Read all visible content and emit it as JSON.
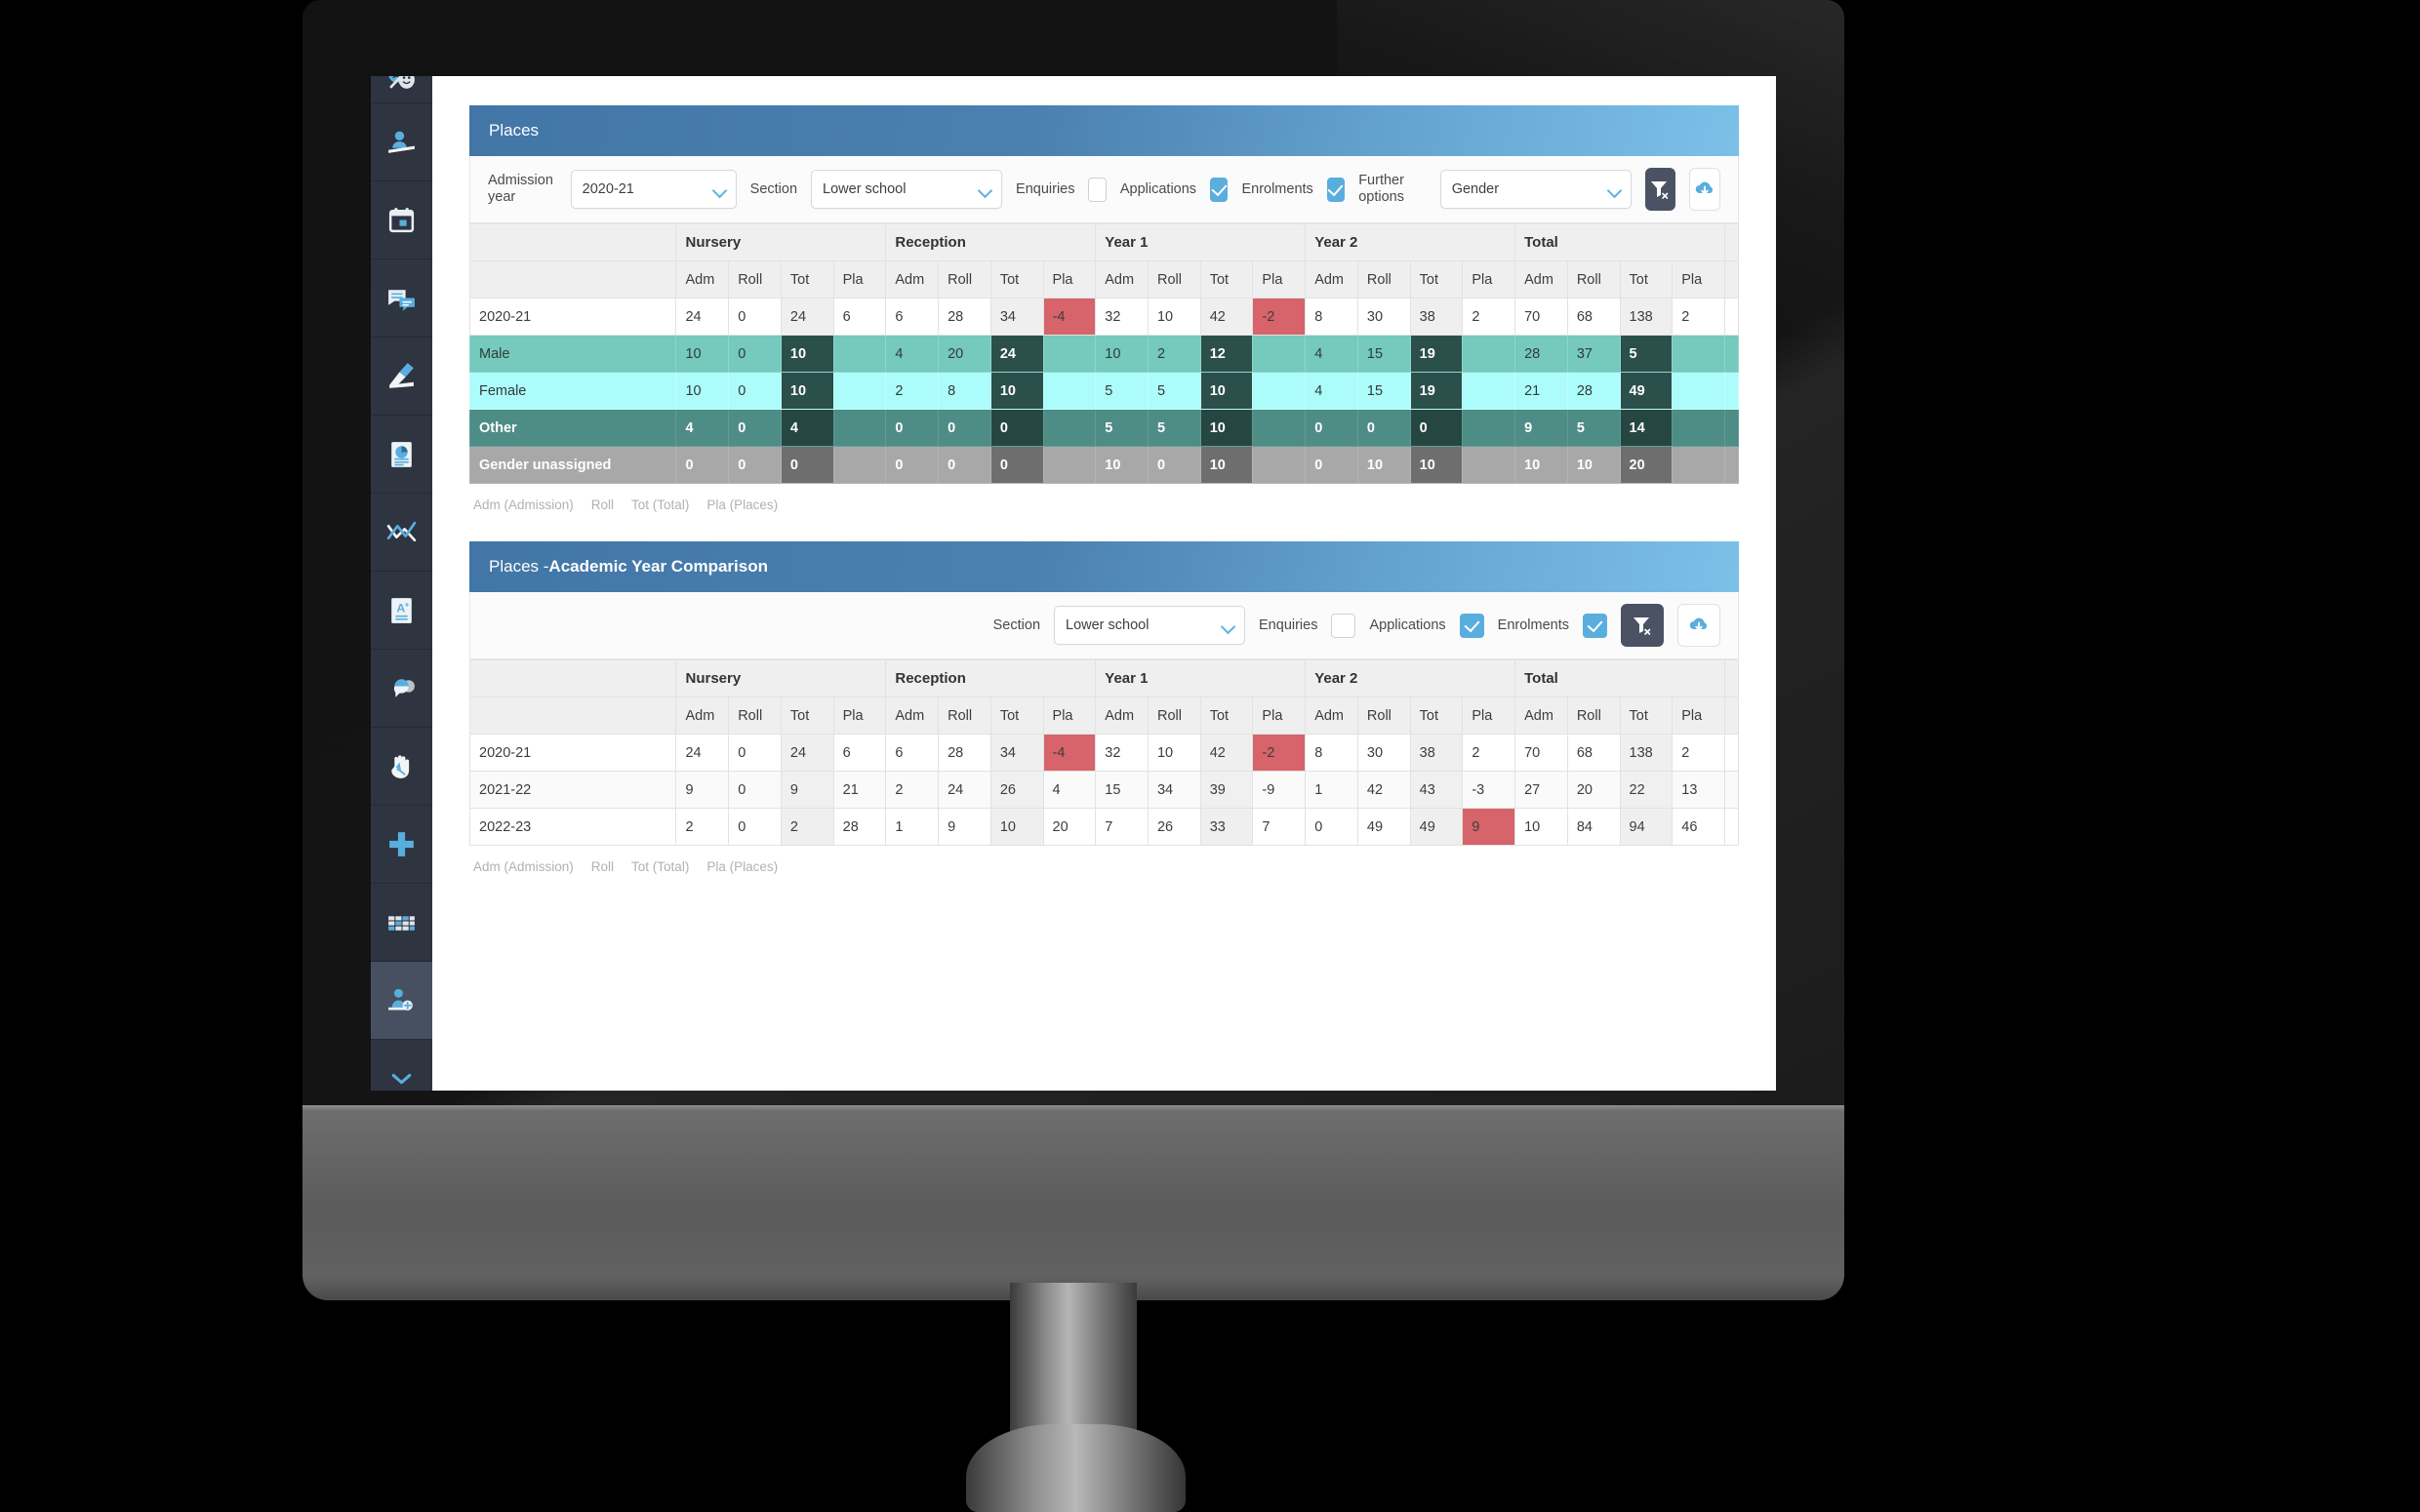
{
  "sidebar": {
    "items": [
      {
        "name": "drama-masks-icon",
        "label": "Drama"
      },
      {
        "name": "graduation-person-icon",
        "label": "Alumni"
      },
      {
        "name": "calendar-icon",
        "label": "Calendar"
      },
      {
        "name": "messages-icon",
        "label": "Communications"
      },
      {
        "name": "signature-pen-icon",
        "label": "Registration"
      },
      {
        "name": "report-chart-icon",
        "label": "Reports"
      },
      {
        "name": "analytics-line-icon",
        "label": "Analytics"
      },
      {
        "name": "grade-a-plus-icon",
        "label": "Grades"
      },
      {
        "name": "speech-bubbles-icon",
        "label": "Feedback"
      },
      {
        "name": "hand-icon",
        "label": "Pastoral"
      },
      {
        "name": "medical-cross-icon",
        "label": "Medical"
      },
      {
        "name": "timetable-grid-icon",
        "label": "Timetable"
      },
      {
        "name": "admissions-add-person-icon",
        "label": "Admissions",
        "active": true
      }
    ]
  },
  "panel_places": {
    "title": "Places",
    "toolbar": {
      "admission_year_label": "Admission year",
      "admission_year_value": "2020-21",
      "section_label": "Section",
      "section_value": "Lower school",
      "enquiries_label": "Enquiries",
      "enquiries_checked": false,
      "applications_label": "Applications",
      "applications_checked": true,
      "enrolments_label": "Enrolments",
      "enrolments_checked": true,
      "further_options_label": "Further options",
      "further_options_value": "Gender",
      "clear_filter_icon": "filter-clear-icon",
      "download_icon": "cloud-download-icon"
    },
    "groups": [
      "Nursery",
      "Reception",
      "Year 1",
      "Year 2",
      "Total"
    ],
    "subheaders": [
      "Adm",
      "Roll",
      "Tot",
      "Pla"
    ],
    "rows": [
      {
        "label": "2020-21",
        "style": "plain",
        "cells": [
          "24",
          "0",
          "24",
          "6",
          "6",
          "28",
          "34",
          "-4",
          "32",
          "10",
          "42",
          "-2",
          "8",
          "30",
          "38",
          "2",
          "70",
          "68",
          "138",
          "2"
        ],
        "neg": [
          7,
          11
        ]
      },
      {
        "label": "Male",
        "style": "male",
        "cells": [
          "10",
          "0",
          "10",
          "",
          "4",
          "20",
          "24",
          "",
          "10",
          "2",
          "12",
          "",
          "4",
          "15",
          "19",
          "",
          "28",
          "37",
          "5",
          ""
        ],
        "neg": []
      },
      {
        "label": "Female",
        "style": "female",
        "cells": [
          "10",
          "0",
          "10",
          "",
          "2",
          "8",
          "10",
          "",
          "5",
          "5",
          "10",
          "",
          "4",
          "15",
          "19",
          "",
          "21",
          "28",
          "49",
          ""
        ],
        "neg": []
      },
      {
        "label": "Other",
        "style": "other",
        "cells": [
          "4",
          "0",
          "4",
          "",
          "0",
          "0",
          "0",
          "",
          "5",
          "5",
          "10",
          "",
          "0",
          "0",
          "0",
          "",
          "9",
          "5",
          "14",
          ""
        ],
        "neg": []
      },
      {
        "label": "Gender unassigned",
        "style": "unassigned",
        "cells": [
          "0",
          "0",
          "0",
          "",
          "0",
          "0",
          "0",
          "",
          "10",
          "0",
          "10",
          "",
          "0",
          "10",
          "10",
          "",
          "10",
          "10",
          "20",
          ""
        ],
        "neg": []
      }
    ],
    "legend": [
      "Adm (Admission)",
      "Roll",
      "Tot (Total)",
      "Pla (Places)"
    ]
  },
  "panel_comparison": {
    "title_light": "Places - ",
    "title_bold": "Academic Year Comparison",
    "toolbar": {
      "section_label": "Section",
      "section_value": "Lower school",
      "enquiries_label": "Enquiries",
      "enquiries_checked": false,
      "applications_label": "Applications",
      "applications_checked": true,
      "enrolments_label": "Enrolments",
      "enrolments_checked": true,
      "clear_filter_icon": "filter-clear-icon",
      "download_icon": "cloud-download-icon"
    },
    "groups": [
      "Nursery",
      "Reception",
      "Year 1",
      "Year 2",
      "Total"
    ],
    "subheaders": [
      "Adm",
      "Roll",
      "Tot",
      "Pla"
    ],
    "rows": [
      {
        "label": "2020-21",
        "style": "plain",
        "cells": [
          "24",
          "0",
          "24",
          "6",
          "6",
          "28",
          "34",
          "-4",
          "32",
          "10",
          "42",
          "-2",
          "8",
          "30",
          "38",
          "2",
          "70",
          "68",
          "138",
          "2"
        ],
        "neg": [
          7,
          11
        ]
      },
      {
        "label": "2021-22",
        "style": "zebra",
        "cells": [
          "9",
          "0",
          "9",
          "21",
          "2",
          "24",
          "26",
          "4",
          "15",
          "34",
          "39",
          "-9",
          "1",
          "42",
          "43",
          "-3",
          "27",
          "20",
          "22",
          "13"
        ],
        "neg": [
          11,
          15
        ]
      },
      {
        "label": "2022-23",
        "style": "plain",
        "cells": [
          "2",
          "0",
          "2",
          "28",
          "1",
          "9",
          "10",
          "20",
          "7",
          "26",
          "33",
          "7",
          "0",
          "49",
          "49",
          "9",
          "10",
          "84",
          "94",
          "46"
        ],
        "neg": [
          15
        ]
      }
    ],
    "legend": [
      "Adm (Admission)",
      "Roll",
      "Tot (Total)",
      "Pla (Places)"
    ]
  },
  "colors": {
    "header_blue": "#4176a6",
    "header_blue_light": "#7cc0e8",
    "accent_blue": "#5aaede",
    "negative_red": "#d6646a",
    "male_teal": "#75c9bd",
    "female_cyan": "#adfcfc",
    "other_teal": "#4e8d85",
    "unassigned_gray": "#a8a8a8",
    "sidebar_dark": "#2e3440"
  }
}
